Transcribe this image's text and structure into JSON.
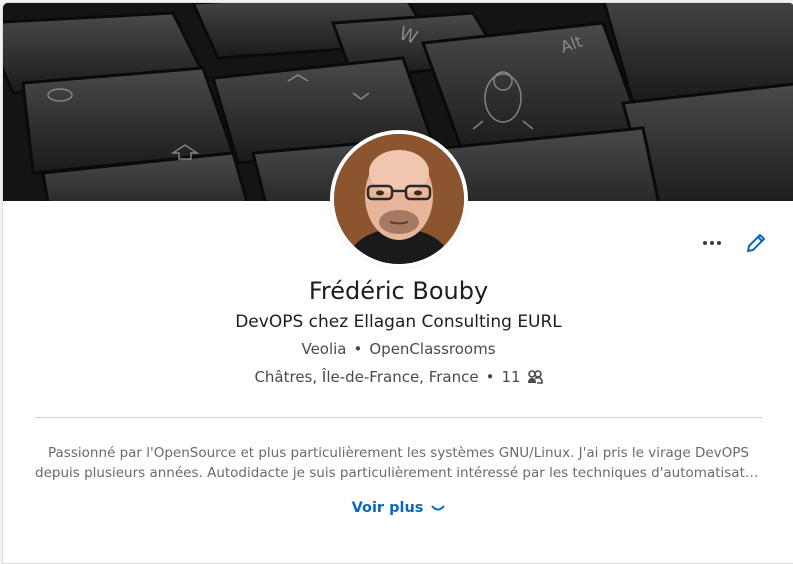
{
  "profile": {
    "name": "Frédéric Bouby",
    "headline": "DevOPS chez Ellagan Consulting EURL",
    "company": "Veolia",
    "school": "OpenClassrooms",
    "location": "Châtres, Île-de-France, France",
    "connections": "11",
    "separator": "•"
  },
  "about": {
    "line1": "Passionné par l'OpenSource et plus particulièrement les systèmes GNU/Linux. J'ai pris le virage DevOPS",
    "line2": "depuis plusieurs années. Autodidacte je suis particulièrement intéressé par les techniques d'automatisation",
    "see_more": "Voir plus"
  },
  "icons": {
    "more": "more-horizontal-icon",
    "edit": "pencil-icon",
    "connections": "people-icon",
    "chevron": "chevron-down-icon"
  },
  "colors": {
    "accent": "#0a66c2",
    "text": "#1d1d1d",
    "secondary": "#4a4a4a"
  }
}
